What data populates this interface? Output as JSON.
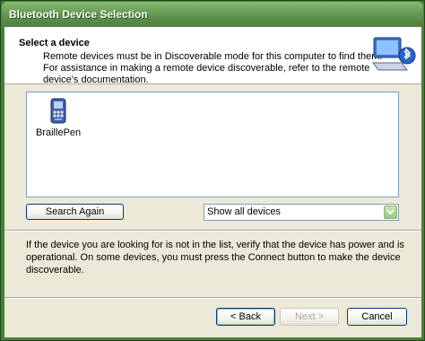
{
  "window": {
    "title": "Bluetooth Device Selection"
  },
  "header": {
    "title": "Select a device",
    "desc_lines": [
      "Remote devices must be in Discoverable mode for this computer to find them.",
      "For assistance in making a remote device discoverable, refer to the remote",
      "device's documentation."
    ],
    "icon": "bluetooth-computer-icon"
  },
  "device_list": {
    "items": [
      {
        "label": "BraillePen",
        "icon": "handheld-device-icon"
      }
    ]
  },
  "controls": {
    "search_again_label": "Search Again",
    "filter_selected": "Show all devices"
  },
  "info": {
    "lines": [
      "If the device you are looking for is not in the list, verify that the device has power and is",
      "operational. On some devices, you must press the Connect button to make the device",
      "discoverable."
    ]
  },
  "footer": {
    "back_label": "< Back",
    "next_label": "Next >",
    "cancel_label": "Cancel"
  },
  "colors": {
    "titlebar": "#6ea159",
    "client": "#ece9d8",
    "accent": "#003c74"
  }
}
